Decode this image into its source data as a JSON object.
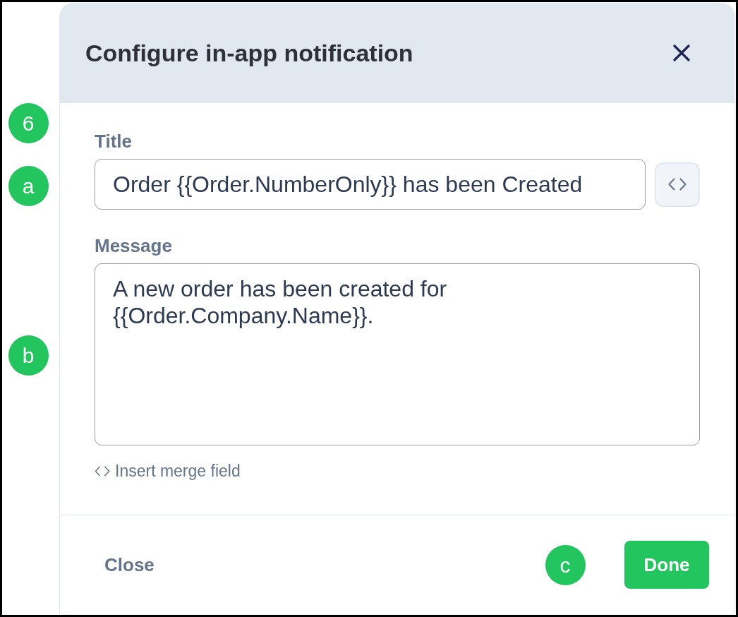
{
  "dialog": {
    "title": "Configure in-app notification",
    "fields": [
      {
        "kind": "input",
        "label": "Title",
        "value": "Order {{Order.NumberOnly}} has been Created"
      },
      {
        "kind": "textarea",
        "label": "Message",
        "value": "A new order has been created for {{Order.Company.Name}}.",
        "link": "Insert merge field"
      }
    ],
    "footer": {
      "buttons": [
        {
          "kind": "text",
          "label": "Close"
        },
        {
          "kind": "primary",
          "label": "Done"
        }
      ]
    }
  },
  "callouts": [
    {
      "label": "6"
    },
    {
      "label": "a"
    },
    {
      "label": "b"
    },
    {
      "label": "c"
    }
  ]
}
